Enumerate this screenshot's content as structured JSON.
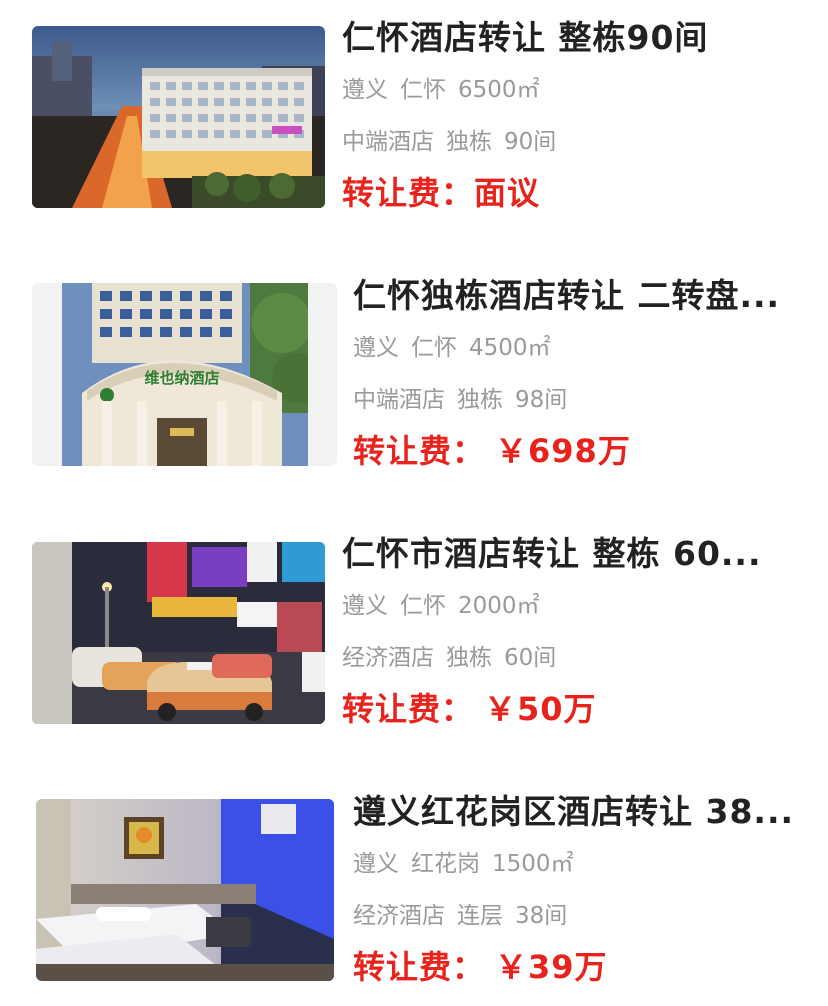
{
  "listings": [
    {
      "title": "仁怀酒店转让 整栋90间",
      "location": "遵义",
      "district": "仁怀",
      "area": "6500㎡",
      "grade": "中端酒店",
      "building": "独栋",
      "rooms": "90间",
      "price_label": "转让费：",
      "price_value": "面议"
    },
    {
      "title": "仁怀独栋酒店转让 二转盘...",
      "location": "遵义",
      "district": "仁怀",
      "area": "4500㎡",
      "grade": "中端酒店",
      "building": "独栋",
      "rooms": "98间",
      "price_label": "转让费：",
      "price_value": "￥698万",
      "sign_text": "维也纳酒店"
    },
    {
      "title": "仁怀市酒店转让 整栋 60...",
      "location": "遵义",
      "district": "仁怀",
      "area": "2000㎡",
      "grade": "经济酒店",
      "building": "独栋",
      "rooms": "60间",
      "price_label": "转让费：",
      "price_value": "￥50万"
    },
    {
      "title": "遵义红花岗区酒店转让 38...",
      "location": "遵义",
      "district": "红花岗",
      "area": "1500㎡",
      "grade": "经济酒店",
      "building": "连层",
      "rooms": "38间",
      "price_label": "转让费：",
      "price_value": "￥39万"
    }
  ]
}
